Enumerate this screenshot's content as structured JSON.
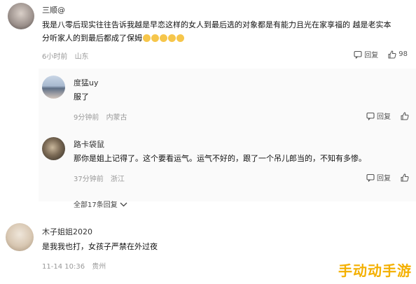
{
  "comments": [
    {
      "username": "三顺@",
      "text_line1": "我是八零后现实往往告诉我越是早恋这样的女人到最后选的对象都是有能力且光在家享福的 越是老实本",
      "text_line2": "分听家人的到最后都成了保姆",
      "emoji_count": 5,
      "time": "6小时前",
      "location": "山东",
      "reply_label": "回复",
      "like_count": "98"
    },
    {
      "username": "度猛uy",
      "text": "服了",
      "time": "9分钟前",
      "location": "内蒙古",
      "reply_label": "回复",
      "like_count": ""
    },
    {
      "username": "路卡袋鼠",
      "text": "那你是姐上记得了。这个要看运气。运气不好的，跟了一个吊儿郎当的，不知有多惨。",
      "time": "37分钟前",
      "location": "浙江",
      "reply_label": "回复",
      "like_count": ""
    },
    {
      "username": "木子姐姐2020",
      "text": "是我我也打，女孩子严禁在外过夜",
      "time": "11-14 10:36",
      "location": "贵州",
      "reply_label": "",
      "like_count": ""
    }
  ],
  "expand_replies": "全部17条回复",
  "watermark": "手动动手游",
  "colors": {
    "accent": "#f4b000",
    "meta": "#999999"
  }
}
